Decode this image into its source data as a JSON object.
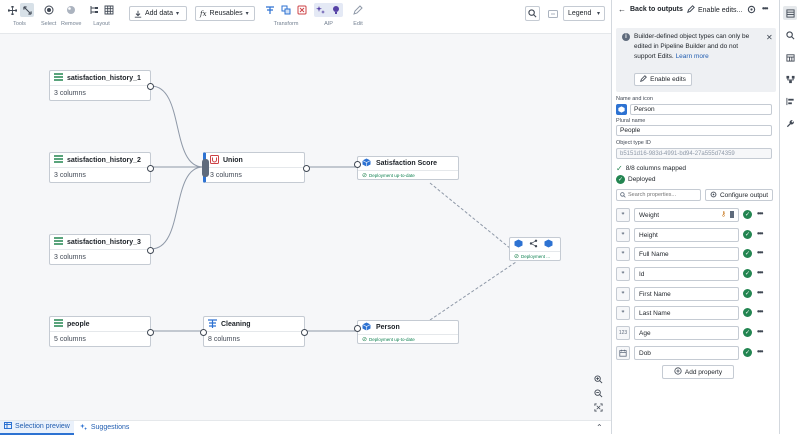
{
  "toolbar": {
    "groups": {
      "tools": "Tools",
      "select": "Select",
      "remove": "Remove",
      "layout": "Layout",
      "transform": "Transform",
      "aip": "AIP",
      "edit": "Edit"
    },
    "add_data": "Add data",
    "reusables": "Reusables",
    "legend": "Legend"
  },
  "canvas": {
    "datasets": [
      {
        "name": "satisfaction_history_1",
        "columns": "3 columns"
      },
      {
        "name": "satisfaction_history_2",
        "columns": "3 columns"
      },
      {
        "name": "satisfaction_history_3",
        "columns": "3 columns"
      },
      {
        "name": "people",
        "columns": "5 columns"
      }
    ],
    "transforms": [
      {
        "name": "Union",
        "columns": "3 columns"
      },
      {
        "name": "Cleaning",
        "columns": "8 columns"
      }
    ],
    "objects": [
      {
        "name": "Satisfaction Score",
        "status": "Deployment up-to-date"
      },
      {
        "name": "Person",
        "status": "Deployment up-to-date"
      }
    ],
    "link_status": "Deployment ...",
    "zoom_in": "+",
    "zoom_out": "−"
  },
  "bottombar": {
    "selection_preview": "Selection preview",
    "suggestions": "Suggestions"
  },
  "panel": {
    "back": "Back to outputs",
    "enable_edits_header": "Enable edits...",
    "callout_text": "Builder-defined object types can only be edited in Pipeline Builder and do not support Edits.",
    "callout_link": "Learn more",
    "enable_edits_button": "Enable edits",
    "name_label": "Name and icon",
    "name_value": "Person",
    "plural_label": "Plural name",
    "plural_value": "People",
    "id_label": "Object type ID",
    "id_value": "b5151d16-983d-4991-bd94-27a555d74359",
    "mapped": "8/8 columns mapped",
    "deployed": "Deployed",
    "search_placeholder": "Search properties...",
    "configure_output": "Configure output",
    "properties": [
      {
        "name": "Weight",
        "type": "99"
      },
      {
        "name": "Height",
        "type": "99"
      },
      {
        "name": "Full Name",
        "type": "99"
      },
      {
        "name": "Id",
        "type": "99"
      },
      {
        "name": "First Name",
        "type": "99"
      },
      {
        "name": "Last Name",
        "type": "99"
      },
      {
        "name": "Age",
        "type": "123"
      },
      {
        "name": "Dob",
        "type": "cal"
      }
    ],
    "add_property": "Add property"
  },
  "colors": {
    "accent": "#2d72d2",
    "success": "#238551",
    "canvas_bg": "#f6f7f9"
  }
}
